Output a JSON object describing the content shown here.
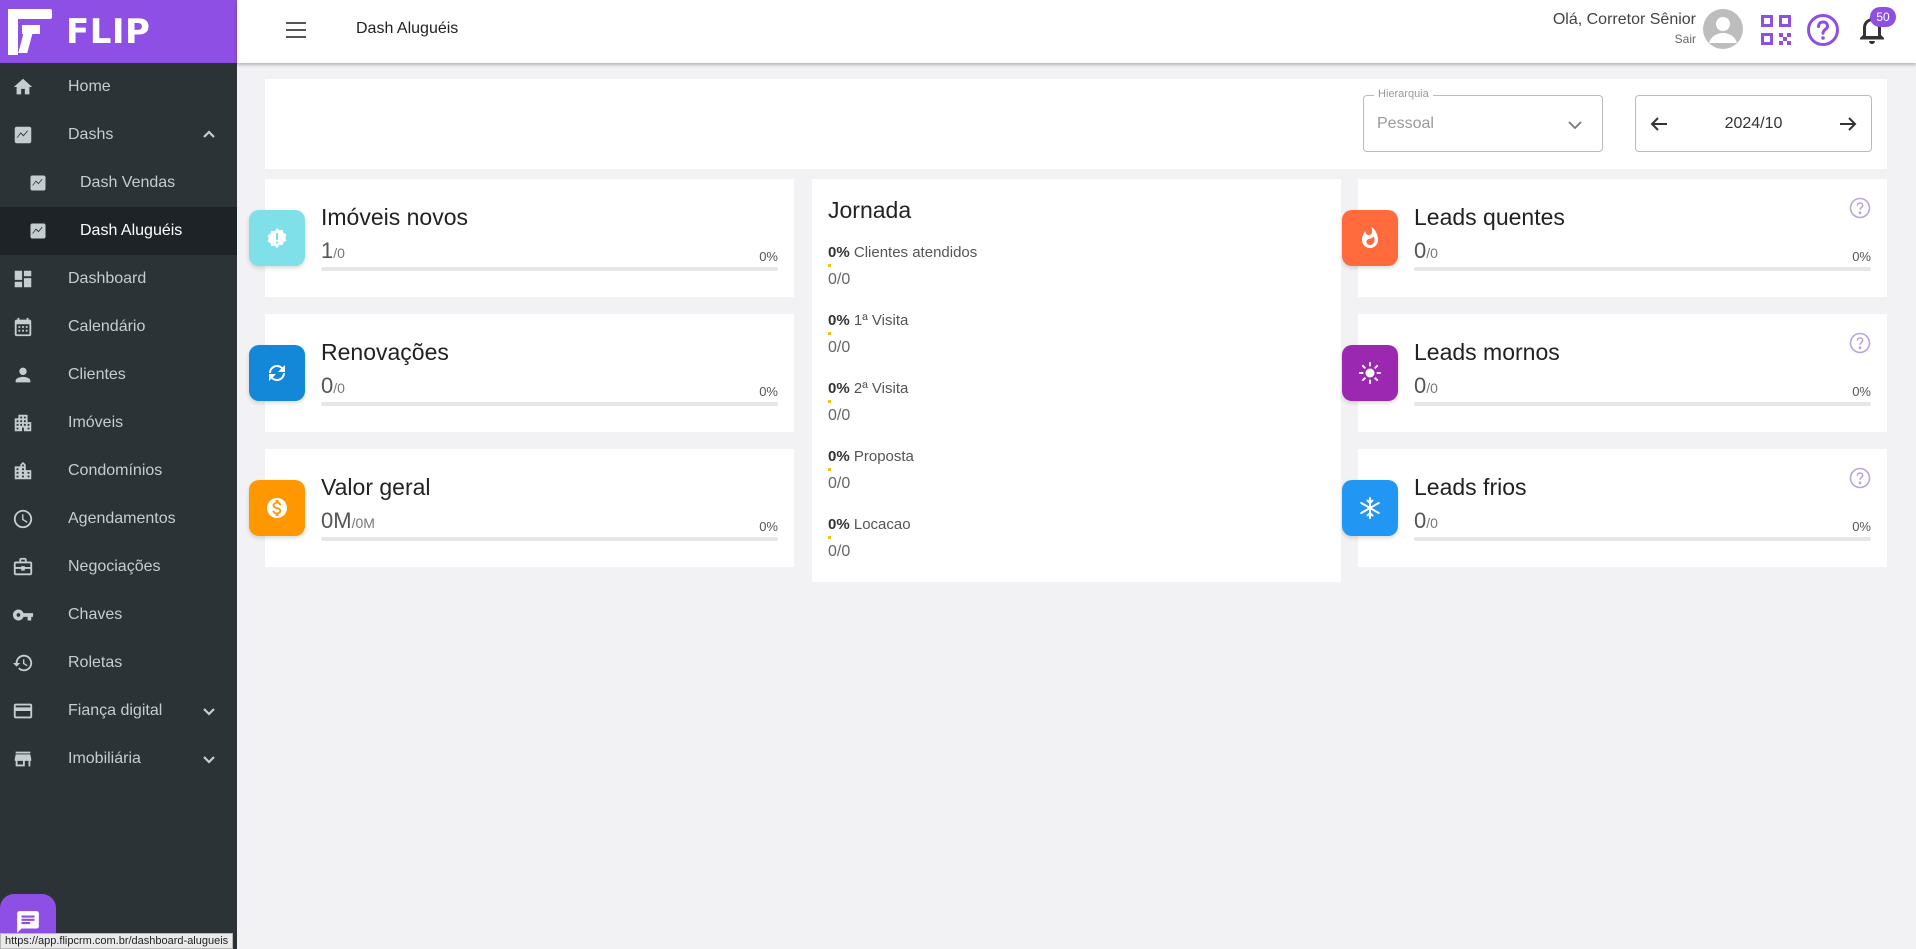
{
  "brand": {
    "name": "FLIP",
    "accent": "#8e4fe4"
  },
  "sidebar": {
    "items": [
      {
        "label": "Home",
        "icon": "home-icon"
      },
      {
        "label": "Dashs",
        "icon": "chart-icon",
        "expanded": true
      },
      {
        "label": "Dash Vendas",
        "icon": "chart-box-icon"
      },
      {
        "label": "Dash Aluguéis",
        "icon": "chart-box-icon",
        "active": true
      },
      {
        "label": "Dashboard",
        "icon": "dashboard-icon"
      },
      {
        "label": "Calendário",
        "icon": "calendar-icon"
      },
      {
        "label": "Clientes",
        "icon": "person-icon"
      },
      {
        "label": "Imóveis",
        "icon": "buildings-icon"
      },
      {
        "label": "Condomínios",
        "icon": "condo-icon"
      },
      {
        "label": "Agendamentos",
        "icon": "clock-icon"
      },
      {
        "label": "Negociações",
        "icon": "briefcase-icon"
      },
      {
        "label": "Chaves",
        "icon": "key-icon"
      },
      {
        "label": "Roletas",
        "icon": "rotate-icon"
      },
      {
        "label": "Fiança digital",
        "icon": "card-icon",
        "expandable": true
      },
      {
        "label": "Imobiliária",
        "icon": "store-icon",
        "expandable": true
      }
    ]
  },
  "status_url": "https://app.flipcrm.com.br/dashboard-alugueis",
  "topbar": {
    "title": "Dash Aluguéis",
    "greeting": "Olá, Corretor Sênior",
    "logout": "Sair",
    "notifications": "50"
  },
  "filters": {
    "hierarchy_label": "Hierarquia",
    "hierarchy_value": "Pessoal",
    "period": "2024/10"
  },
  "cards_left": [
    {
      "title": "Imóveis novos",
      "value": "1",
      "denominator": "/0",
      "pct": "0%",
      "progress": 0,
      "color": "#7fe0ea",
      "icon": "alert-badge-icon"
    },
    {
      "title": "Renovações",
      "value": "0",
      "denominator": "/0",
      "pct": "0%",
      "progress": 0,
      "color": "#1488d8",
      "icon": "refresh-icon"
    },
    {
      "title": "Valor geral",
      "value": "0M",
      "denominator": "/0M",
      "pct": "0%",
      "progress": 0,
      "color": "#ff9800",
      "icon": "dollar-icon"
    }
  ],
  "jornada": {
    "title": "Jornada",
    "stages": [
      {
        "pct": "0%",
        "label": "Clientes atendidos",
        "count": "0/0"
      },
      {
        "pct": "0%",
        "label": "1ª Visita",
        "count": "0/0"
      },
      {
        "pct": "0%",
        "label": "2ª Visita",
        "count": "0/0"
      },
      {
        "pct": "0%",
        "label": "Proposta",
        "count": "0/0"
      },
      {
        "pct": "0%",
        "label": "Locacao",
        "count": "0/0"
      }
    ]
  },
  "cards_right": [
    {
      "title": "Leads quentes",
      "value": "0",
      "denominator": "/0",
      "pct": "0%",
      "progress": 0,
      "color": "#ff6b3d",
      "icon": "flame-icon"
    },
    {
      "title": "Leads mornos",
      "value": "0",
      "denominator": "/0",
      "pct": "0%",
      "progress": 0,
      "color": "#9c27b0",
      "icon": "sun-icon"
    },
    {
      "title": "Leads frios",
      "value": "0",
      "denominator": "/0",
      "pct": "0%",
      "progress": 0,
      "color": "#2196f3",
      "icon": "snowflake-icon"
    }
  ]
}
